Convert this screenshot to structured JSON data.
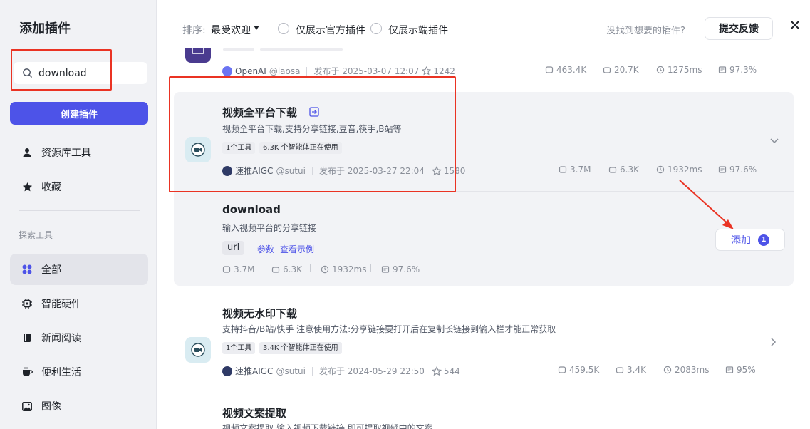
{
  "sidebar": {
    "title": "添加插件",
    "search_value": "download",
    "create_button": "创建插件",
    "items_top": [
      {
        "label": "资源库工具",
        "icon": "person-icon"
      },
      {
        "label": "收藏",
        "icon": "star-icon"
      }
    ],
    "section_label": "探索工具",
    "items": [
      {
        "label": "全部",
        "icon": "grid-icon",
        "active": true
      },
      {
        "label": "智能硬件",
        "icon": "chip-icon"
      },
      {
        "label": "新闻阅读",
        "icon": "book-icon"
      },
      {
        "label": "便利生活",
        "icon": "cup-icon"
      },
      {
        "label": "图像",
        "icon": "image-icon"
      }
    ]
  },
  "toolbar": {
    "sort_label": "排序:",
    "sort_value": "最受欢迎",
    "filter_official": "仅展示官方插件",
    "filter_device": "仅展示端插件",
    "not_found": "没找到想要的插件?",
    "feedback_button": "提交反馈"
  },
  "plugins": [
    {
      "author": "OpenAI",
      "handle": "@laosa",
      "published": "发布于 2025-03-07 12:07",
      "stars": "1242",
      "stats": {
        "calls": "463.4K",
        "bots": "20.7K",
        "latency": "1275ms",
        "success": "97.3%"
      }
    },
    {
      "title": "视频全平台下载",
      "desc": "视频全平台下载,支持分享链接,豆音,筷手,B站等",
      "tags": [
        "1个工具",
        "6.3K 个智能体正在使用"
      ],
      "author": "速推AIGC",
      "handle": "@sutui",
      "published": "发布于 2025-03-27 22:04",
      "stars": "1580",
      "stats": {
        "calls": "3.7M",
        "bots": "6.3K",
        "latency": "1932ms",
        "success": "97.6%"
      },
      "tool": {
        "name": "download",
        "desc": "输入视频平台的分享链接",
        "param": "url",
        "params_link": "参数",
        "example_link": "查看示例",
        "stats": {
          "calls": "3.7M",
          "bots": "6.3K",
          "latency": "1932ms",
          "success": "97.6%"
        },
        "add_button": "添加",
        "add_count": "1"
      }
    },
    {
      "title": "视频无水印下载",
      "desc": "支持抖音/B站/快手 注意使用方法:分享链接要打开后在复制长链接到输入栏才能正常获取",
      "tags": [
        "1个工具",
        "3.4K 个智能体正在使用"
      ],
      "author": "速推AIGC",
      "handle": "@sutui",
      "published": "发布于 2024-05-29 22:50",
      "stars": "544",
      "stats": {
        "calls": "459.5K",
        "bots": "3.4K",
        "latency": "2083ms",
        "success": "95%"
      }
    },
    {
      "title": "视频文案提取",
      "desc": "视频文案提取,输入视频下载链接,即可提取视频中的文案。"
    }
  ],
  "colors": {
    "accent": "#4d53e8",
    "highlight": "#ea3323"
  }
}
